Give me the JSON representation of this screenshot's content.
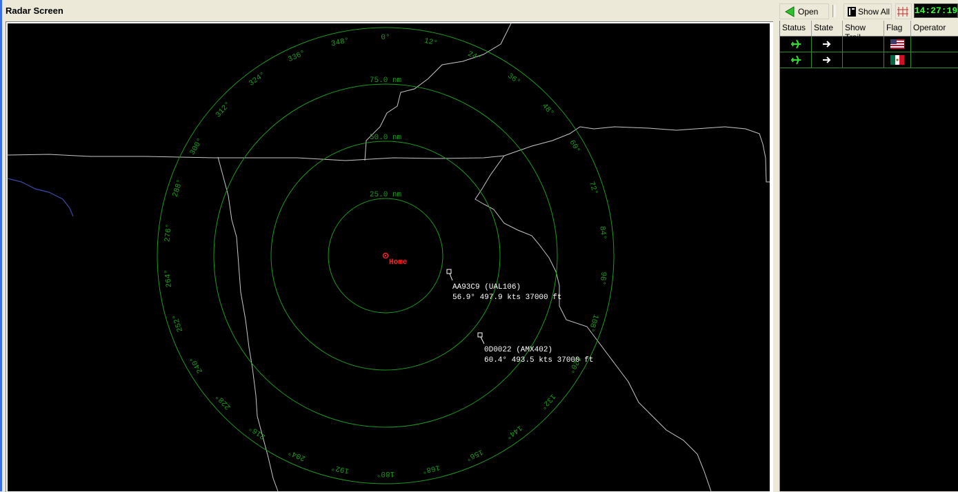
{
  "window": {
    "title": "Radar Screen"
  },
  "toolbar": {
    "open_label": "Open",
    "show_all_label": "Show All",
    "clock": "14:27:19"
  },
  "panel": {
    "columns": [
      "Status",
      "State",
      "Show Trail",
      "Flag",
      "Operator"
    ],
    "rows": [
      {
        "status_icon": "airplane-icon",
        "state_icon": "arrow-right-icon",
        "show_trail": "",
        "flag_icon": "us-flag-icon",
        "operator": ""
      },
      {
        "status_icon": "airplane-icon",
        "state_icon": "arrow-right-icon",
        "show_trail": "",
        "flag_icon": "mexico-flag-icon",
        "operator": ""
      }
    ]
  },
  "radar": {
    "home_label": "Home",
    "range_rings": [
      "25.0 nm",
      "50.0 nm",
      "75.0 nm"
    ],
    "bearings": [
      "0°",
      "12°",
      "24°",
      "36°",
      "48°",
      "60°",
      "72°",
      "84°",
      "96°",
      "108°",
      "120°",
      "132°",
      "144°",
      "156°",
      "168°",
      "180°",
      "192°",
      "204°",
      "216°",
      "228°",
      "240°",
      "252°",
      "264°",
      "276°",
      "288°",
      "300°",
      "312°",
      "324°",
      "336°",
      "348°"
    ],
    "aircraft": [
      {
        "id": "AA93C9 (UAL106)",
        "info": "56.9° 497.9 kts 37000 ft"
      },
      {
        "id": "0D0022 (AMX402)",
        "info": "60.4° 493.5 kts 37000 ft"
      }
    ],
    "colors": {
      "rings": "#1e9a1e",
      "home": "#ff2020",
      "borders": "#c8c8c8",
      "coast": "#3a4aa8",
      "labels": "#ffffff"
    }
  }
}
